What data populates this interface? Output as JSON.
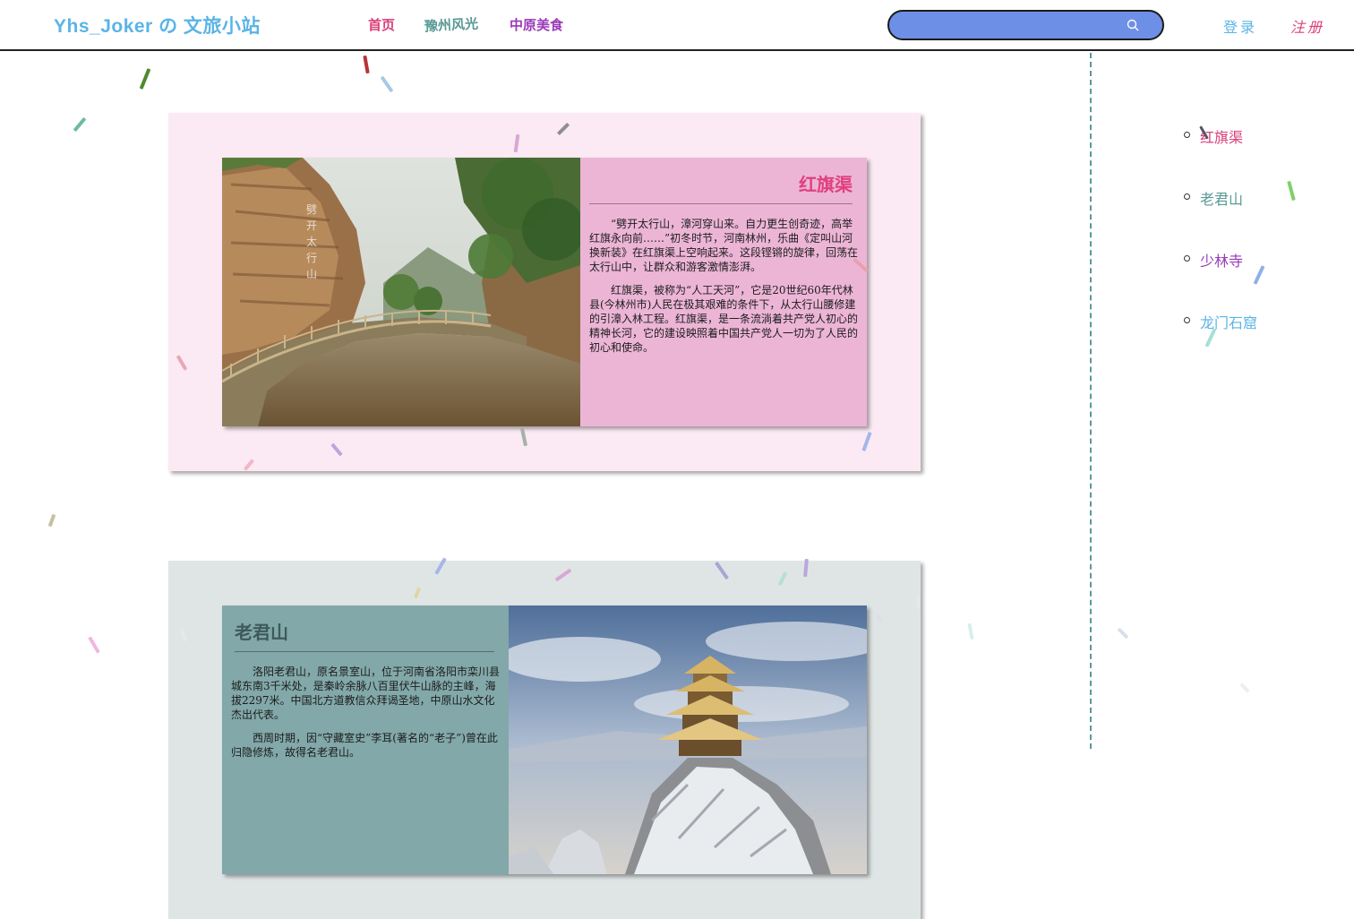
{
  "header": {
    "logo": "Yhs_Joker の 文旅小站",
    "nav": {
      "home": "首页",
      "scenery": "豫州风光",
      "food": "中原美食"
    },
    "search": {
      "placeholder": ""
    },
    "login": "登录",
    "register": "注册"
  },
  "sidebar": {
    "items": [
      {
        "label": "红旗渠",
        "color": "#d9417a"
      },
      {
        "label": "老君山",
        "color": "#5a9a96"
      },
      {
        "label": "少林寺",
        "color": "#9a3ab8"
      },
      {
        "label": "龙门石窟",
        "color": "#5ab4e6"
      }
    ]
  },
  "cards": [
    {
      "title": "红旗渠",
      "paragraphs": [
        "“劈开太行山，漳河穿山来。自力更生创奇迹，高举红旗永向前……”初冬时节，河南林州，乐曲《定叫山河换新装》在红旗渠上空响起来。这段铿锵的旋律，回荡在太行山中，让群众和游客激情澎湃。",
        "红旗渠，被称为“人工天河”，它是20世纪60年代林县(今林州市)人民在极其艰难的条件下，从太行山腰修建的引漳入林工程。红旗渠，是一条流淌着共产党人初心的精神长河，它的建设映照着中国共产党人一切为了人民的初心和使命。"
      ]
    },
    {
      "title": "老君山",
      "paragraphs": [
        "洛阳老君山，原名景室山，位于河南省洛阳市栾川县城东南3千米处，是秦岭余脉八百里伏牛山脉的主峰，海拔2297米。中国北方道教信众拜谒圣地，中原山水文化杰出代表。",
        "西周时期，因“守藏室史”李耳(著名的“老子”)曾在此归隐修炼，故得名老君山。"
      ]
    }
  ],
  "colors": {
    "accent_blue": "#5ab4e6",
    "accent_pink": "#d9417a",
    "search_bg": "#6e8fe6",
    "divider": "#5a9a96"
  }
}
